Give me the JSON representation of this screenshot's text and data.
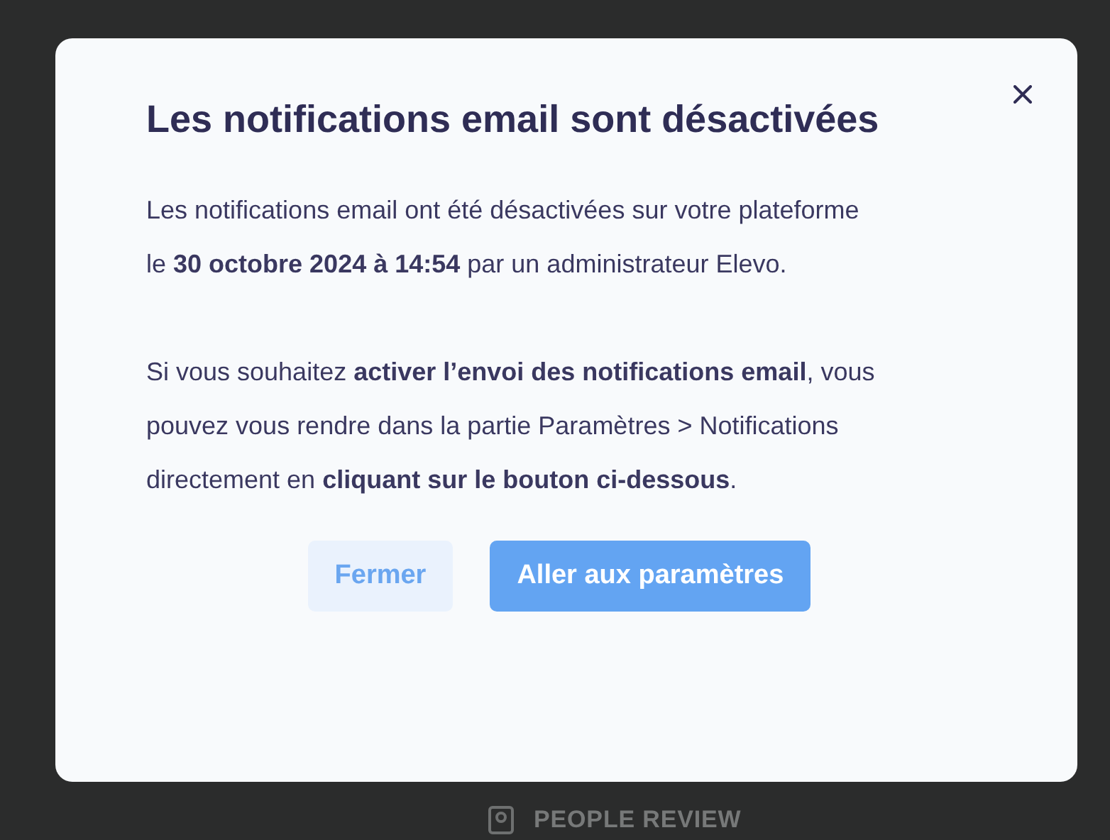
{
  "background": {
    "menu_item": "PEOPLE REVIEW"
  },
  "dialog": {
    "title": "Les notifications email sont désactivées",
    "paragraphs": [
      "Les notifications email ont été désactivées sur votre plateforme le **30 octobre 2024 à 14:54** par un administrateur Elevo.",
      "Si vous souhaitez **activer l’envoi des notifications email**, vous pouvez vous rendre dans la partie Paramètres > Notifications directement en **cliquant sur le bouton ci-dessous**."
    ],
    "buttons": [
      {
        "label": "Fermer",
        "kind": "secondary"
      },
      {
        "label": "Aller aux paramètres",
        "kind": "primary"
      }
    ]
  }
}
